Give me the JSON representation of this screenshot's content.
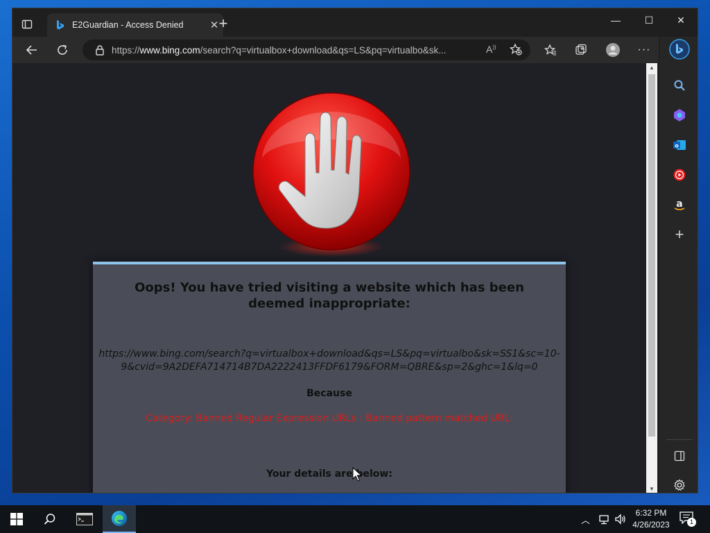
{
  "browser": {
    "tab": {
      "title": "E2Guardian - Access Denied"
    },
    "address_bar": {
      "url_prefix": "https://",
      "url_host": "www.bing.com",
      "url_rest": "/search?q=virtualbox+download&qs=LS&pq=virtualbo&sk..."
    }
  },
  "page": {
    "heading": "Oops! You have tried visiting a website which has been deemed inappropriate:",
    "blocked_url": "https://www.bing.com/search?q=virtualbox+download&qs=LS&pq=virtualbo&sk=SS1&sc=10-9&cvid=9A2DEFA714714B7DA2222413FFDF6179&FORM=QBRE&sp=2&ghc=1&lq=0",
    "because_label": "Because",
    "reason": "Category: Banned Regular Expression URLs : Banned pattern matched URL:",
    "details_label": "Your details are below:"
  },
  "taskbar": {
    "time": "6:32 PM",
    "date": "4/26/2023",
    "notification_count": "1"
  },
  "colors": {
    "accent": "#8fc3ec",
    "reason_text": "#e01a1a",
    "card_bg": "#4a4d57"
  }
}
